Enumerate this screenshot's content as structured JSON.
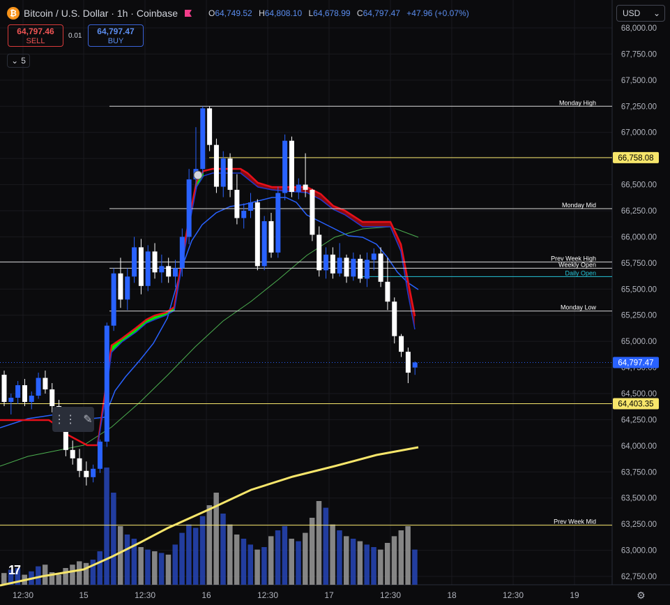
{
  "header": {
    "symbol": "Bitcoin / U.S. Dollar · 1h · Coinbase",
    "ohlc": {
      "o_label": "O",
      "o": "64,749.52",
      "h_label": "H",
      "h": "64,808.10",
      "l_label": "L",
      "l": "64,678.99",
      "c_label": "C",
      "c": "64,797.47",
      "change": "+47.96 (+0.07%)"
    }
  },
  "trade": {
    "sell_price": "64,797.46",
    "sell_label": "SELL",
    "spread": "0.01",
    "buy_price": "64,797.47",
    "buy_label": "BUY"
  },
  "indicators_count": "5",
  "currency": "USD",
  "colors": {
    "bg": "#0b0b0d",
    "up": "#2962ff",
    "down": "#ffffff",
    "grid": "#1a1a1e",
    "ma200": "#f7e66b",
    "ma50": "#4caf50",
    "ma20": "#2962ff",
    "stop_red": "#e8101a",
    "stop_green": "#00e600",
    "level": "#ffffff",
    "level_yellow": "#f7e66b",
    "daily_open": "#26c6da"
  },
  "chart_data": {
    "type": "candlestick",
    "ylim": [
      62750,
      68000
    ],
    "y_ticks": [
      "68,000.00",
      "67,750.00",
      "67,500.00",
      "67,250.00",
      "67,000.00",
      "66,750.00",
      "66,500.00",
      "66,250.00",
      "66,000.00",
      "65,750.00",
      "65,500.00",
      "65,250.00",
      "65,000.00",
      "64,750.00",
      "64,500.00",
      "64,250.00",
      "64,000.00",
      "63,750.00",
      "63,500.00",
      "63,250.00",
      "63,000.00",
      "62,750.00"
    ],
    "x_ticks": [
      "12:30",
      "15",
      "12:30",
      "16",
      "12:30",
      "17",
      "12:30",
      "18",
      "12:30",
      "19"
    ],
    "last_price": {
      "value": 64797.47,
      "label": "64,797.47"
    },
    "levels": [
      {
        "name": "Monday High",
        "value": 67250,
        "x_start": 157,
        "color": "white"
      },
      {
        "name": "",
        "value": 66758.08,
        "x_start": 300,
        "color": "yellow",
        "price_label": "66,758.08"
      },
      {
        "name": "Monday Mid",
        "value": 66270,
        "x_start": 157,
        "color": "white"
      },
      {
        "name": "Prev Week High",
        "value": 65760,
        "x_start": 0,
        "color": "white"
      },
      {
        "name": "Weekly Open",
        "value": 65700,
        "x_start": 157,
        "color": "white"
      },
      {
        "name": "Daily Open",
        "value": 65620,
        "x_start": 520,
        "color": "cyan"
      },
      {
        "name": "Monday Low",
        "value": 65290,
        "x_start": 157,
        "color": "white"
      },
      {
        "name": "",
        "value": 64403.35,
        "x_start": 0,
        "color": "yellow",
        "price_label": "64,403.35"
      },
      {
        "name": "Prev Week Mid",
        "value": 63240,
        "x_start": 0,
        "color": "yellow"
      }
    ],
    "candles": [
      [
        64680,
        64720,
        64380,
        64420
      ],
      [
        64420,
        64500,
        64300,
        64460
      ],
      [
        64460,
        64620,
        64400,
        64580
      ],
      [
        64580,
        64640,
        64380,
        64420
      ],
      [
        64420,
        64520,
        64350,
        64480
      ],
      [
        64480,
        64700,
        64450,
        64650
      ],
      [
        64650,
        64720,
        64500,
        64540
      ],
      [
        64540,
        64600,
        64320,
        64380
      ],
      [
        64380,
        64440,
        64150,
        64220
      ],
      [
        64220,
        64290,
        63900,
        63960
      ],
      [
        63960,
        64050,
        63820,
        63880
      ],
      [
        63880,
        63970,
        63700,
        63760
      ],
      [
        63760,
        63850,
        63620,
        63700
      ],
      [
        63700,
        63820,
        63650,
        63780
      ],
      [
        63780,
        64060,
        63740,
        64040
      ],
      [
        64040,
        65180,
        63990,
        65150
      ],
      [
        65150,
        65700,
        65100,
        65650
      ],
      [
        65650,
        65800,
        65320,
        65400
      ],
      [
        65400,
        65700,
        65300,
        65620
      ],
      [
        65620,
        66000,
        65560,
        65900
      ],
      [
        65900,
        65980,
        65450,
        65530
      ],
      [
        65530,
        65920,
        65480,
        65860
      ],
      [
        65860,
        65940,
        65600,
        65660
      ],
      [
        65660,
        65830,
        65560,
        65720
      ],
      [
        65720,
        65800,
        65560,
        65620
      ],
      [
        65620,
        65780,
        65520,
        65700
      ],
      [
        65700,
        66080,
        65620,
        66000
      ],
      [
        66000,
        66650,
        65930,
        66550
      ],
      [
        66550,
        67050,
        66460,
        66650
      ],
      [
        66650,
        67250,
        66600,
        67230
      ],
      [
        67230,
        67250,
        66820,
        66880
      ],
      [
        66880,
        66940,
        66420,
        66480
      ],
      [
        66480,
        66820,
        66380,
        66750
      ],
      [
        66750,
        66800,
        66380,
        66450
      ],
      [
        66450,
        66600,
        66120,
        66180
      ],
      [
        66180,
        66320,
        66080,
        66250
      ],
      [
        66250,
        66420,
        66180,
        66330
      ],
      [
        66330,
        66360,
        65680,
        65720
      ],
      [
        65720,
        66200,
        65680,
        66150
      ],
      [
        66150,
        66230,
        65800,
        65850
      ],
      [
        65850,
        66480,
        65800,
        66420
      ],
      [
        66420,
        66980,
        66350,
        66920
      ],
      [
        66920,
        66960,
        66380,
        66430
      ],
      [
        66430,
        66560,
        66360,
        66500
      ],
      [
        66500,
        66800,
        66380,
        66450
      ],
      [
        66450,
        66460,
        65960,
        66020
      ],
      [
        66020,
        66100,
        65620,
        65680
      ],
      [
        65680,
        65900,
        65600,
        65830
      ],
      [
        65830,
        65900,
        65600,
        65650
      ],
      [
        65650,
        65940,
        65620,
        65800
      ],
      [
        65800,
        65830,
        65560,
        65620
      ],
      [
        65620,
        65850,
        65580,
        65790
      ],
      [
        65790,
        65830,
        65560,
        65600
      ],
      [
        65600,
        65850,
        65520,
        65780
      ],
      [
        65780,
        65890,
        65680,
        65840
      ],
      [
        65840,
        65900,
        65520,
        65570
      ],
      [
        65570,
        65800,
        65300,
        65380
      ],
      [
        65380,
        65420,
        64980,
        65050
      ],
      [
        65050,
        65070,
        64850,
        64900
      ],
      [
        64900,
        64940,
        64600,
        64700
      ],
      [
        64749.52,
        64808.1,
        64678.99,
        64797.47
      ]
    ],
    "volumes": [
      14,
      18,
      20,
      12,
      16,
      22,
      24,
      15,
      12,
      20,
      24,
      28,
      26,
      30,
      40,
      140,
      110,
      70,
      60,
      55,
      45,
      42,
      40,
      38,
      36,
      48,
      62,
      72,
      68,
      82,
      95,
      110,
      85,
      72,
      60,
      55,
      48,
      42,
      45,
      58,
      65,
      70,
      55,
      52,
      62,
      80,
      100,
      92,
      72,
      65,
      58,
      55,
      52,
      48,
      45,
      42,
      50,
      58,
      65,
      70,
      42
    ],
    "ma200": [
      [
        0,
        839
      ],
      [
        60,
        826
      ],
      [
        120,
        816
      ],
      [
        160,
        798
      ],
      [
        200,
        778
      ],
      [
        240,
        757
      ],
      [
        300,
        730
      ],
      [
        360,
        702
      ],
      [
        420,
        683
      ],
      [
        480,
        668
      ],
      [
        540,
        652
      ],
      [
        600,
        641
      ]
    ],
    "ma50": [
      [
        0,
        668
      ],
      [
        40,
        654
      ],
      [
        80,
        646
      ],
      [
        120,
        638
      ],
      [
        160,
        612
      ],
      [
        200,
        577
      ],
      [
        240,
        538
      ],
      [
        280,
        497
      ],
      [
        320,
        460
      ],
      [
        360,
        432
      ],
      [
        400,
        400
      ],
      [
        440,
        366
      ],
      [
        480,
        340
      ],
      [
        520,
        328
      ],
      [
        560,
        325
      ],
      [
        600,
        340
      ]
    ],
    "ma20": [
      [
        0,
        613
      ],
      [
        40,
        600
      ],
      [
        80,
        594
      ],
      [
        110,
        598
      ],
      [
        130,
        600
      ],
      [
        150,
        598
      ],
      [
        165,
        560
      ],
      [
        180,
        540
      ],
      [
        200,
        517
      ],
      [
        220,
        492
      ],
      [
        240,
        456
      ],
      [
        260,
        386
      ],
      [
        275,
        345
      ],
      [
        290,
        322
      ],
      [
        310,
        305
      ],
      [
        330,
        296
      ],
      [
        350,
        293
      ],
      [
        370,
        288
      ],
      [
        390,
        283
      ],
      [
        410,
        283
      ],
      [
        425,
        290
      ],
      [
        440,
        308
      ],
      [
        460,
        318
      ],
      [
        480,
        328
      ],
      [
        500,
        338
      ],
      [
        520,
        340
      ],
      [
        540,
        350
      ],
      [
        555,
        368
      ],
      [
        570,
        390
      ],
      [
        585,
        405
      ],
      [
        600,
        415
      ]
    ],
    "stop_line": [
      [
        0,
        602
      ],
      [
        70,
        602
      ],
      [
        85,
        612
      ],
      [
        95,
        622
      ],
      [
        110,
        630
      ],
      [
        125,
        638
      ],
      [
        140,
        638
      ],
      [
        150,
        568
      ],
      [
        160,
        495
      ],
      [
        175,
        485
      ],
      [
        195,
        470
      ],
      [
        210,
        458
      ],
      [
        222,
        452
      ],
      [
        238,
        448
      ],
      [
        250,
        440
      ],
      [
        258,
        390
      ],
      [
        270,
        320
      ],
      [
        282,
        260
      ],
      [
        292,
        245
      ],
      [
        305,
        242
      ],
      [
        345,
        242
      ],
      [
        355,
        248
      ],
      [
        370,
        262
      ],
      [
        390,
        268
      ],
      [
        410,
        268
      ],
      [
        440,
        268
      ],
      [
        460,
        278
      ],
      [
        478,
        295
      ],
      [
        495,
        302
      ],
      [
        520,
        318
      ],
      [
        560,
        318
      ],
      [
        575,
        350
      ],
      [
        585,
        402
      ],
      [
        595,
        453
      ]
    ],
    "stop_band": [
      [
        140,
        638
      ],
      [
        150,
        578
      ],
      [
        160,
        505
      ],
      [
        175,
        490
      ],
      [
        195,
        476
      ],
      [
        210,
        463
      ],
      [
        222,
        458
      ],
      [
        238,
        452
      ],
      [
        250,
        445
      ],
      [
        258,
        398
      ],
      [
        270,
        330
      ],
      [
        282,
        268
      ],
      [
        292,
        252
      ],
      [
        305,
        248
      ],
      [
        345,
        248
      ],
      [
        355,
        256
      ],
      [
        370,
        268
      ],
      [
        390,
        272
      ],
      [
        410,
        274
      ],
      [
        440,
        276
      ],
      [
        460,
        286
      ],
      [
        478,
        300
      ],
      [
        495,
        308
      ],
      [
        520,
        325
      ],
      [
        560,
        325
      ],
      [
        575,
        360
      ],
      [
        585,
        420
      ],
      [
        595,
        472
      ]
    ]
  }
}
